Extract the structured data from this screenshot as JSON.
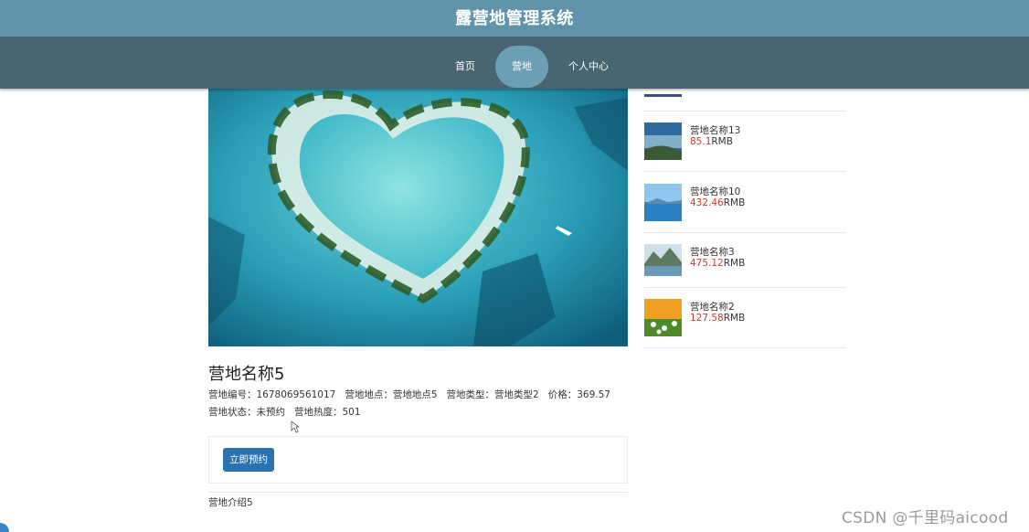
{
  "header": {
    "title": "露营地管理系统"
  },
  "nav": {
    "items": [
      "首页",
      "营地",
      "个人中心"
    ],
    "active_index": 1
  },
  "camp": {
    "name": "营地名称5",
    "fields_line1": [
      {
        "label": "营地编号：",
        "value": "1678069561017"
      },
      {
        "label": "营地地点：",
        "value": "营地地点5"
      },
      {
        "label": "营地类型：",
        "value": "营地类型2"
      },
      {
        "label": "价格：",
        "value": "369.57"
      }
    ],
    "fields_line2": [
      {
        "label": "营地状态：",
        "value": "未预约"
      },
      {
        "label": "营地热度：",
        "value": "501"
      }
    ],
    "book_label": "立即预约",
    "intro": "营地介绍5",
    "image_icon": "heart-island-photo"
  },
  "sidebar": {
    "items": [
      {
        "name": "营地名称13",
        "price": "85.1",
        "unit": "RMB",
        "thumb_icon": "lake-photo"
      },
      {
        "name": "营地名称10",
        "price": "432.46",
        "unit": "RMB",
        "thumb_icon": "sea-photo"
      },
      {
        "name": "营地名称3",
        "price": "475.12",
        "unit": "RMB",
        "thumb_icon": "mountain-lake-photo"
      },
      {
        "name": "营地名称2",
        "price": "127.58",
        "unit": "RMB",
        "thumb_icon": "flower-field-photo"
      }
    ]
  },
  "watermark": "CSDN @千里码aicood",
  "colors": {
    "header": "#5f94aa",
    "nav": "#496570",
    "nav_active": "#6c9eb4",
    "button": "#2a72b0",
    "price": "#c33c2c"
  }
}
